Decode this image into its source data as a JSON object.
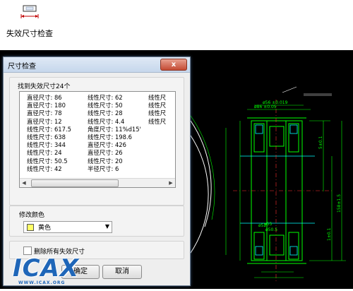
{
  "toolbar": {
    "tool_label": "失效尺寸检查"
  },
  "dialog": {
    "title": "尺寸检查",
    "close_label": "x",
    "found_label": "找到失效尺寸24个",
    "list_col1": [
      "直径尺寸: 86",
      "直径尺寸: 180",
      "直径尺寸: 78",
      "直径尺寸: 12",
      "线性尺寸: 617.5",
      "线性尺寸: 638",
      "线性尺寸: 344",
      "线性尺寸: 24",
      "线性尺寸: 50.5",
      "线性尺寸: 42"
    ],
    "list_col2": [
      "线性尺寸: 62",
      "线性尺寸: 50",
      "线性尺寸: 28",
      "线性尺寸: 4.4",
      "角度尺寸: 11%d15'",
      "线性尺寸: 198.6",
      "直径尺寸: 426",
      "直径尺寸: 26",
      "线性尺寸: 20",
      "半径尺寸: 6"
    ],
    "list_col3": [
      "线性尺",
      "线性尺",
      "线性尺",
      "线性尺"
    ],
    "color_section_label": "修改颜色",
    "color_value": "黄色",
    "color_swatch": "#ffff66",
    "delete_all_label": "删除所有失效尺寸",
    "ok_label": "确定",
    "cancel_label": "取消"
  },
  "watermark": {
    "logo": "ICAX",
    "site": "WWW.ICAX.ORG"
  },
  "colors": {
    "cad_background": "#000000",
    "cad_lines": "#00ff00",
    "cad_accent": "#00ffff",
    "titlebar": "#c6d7ec"
  }
}
